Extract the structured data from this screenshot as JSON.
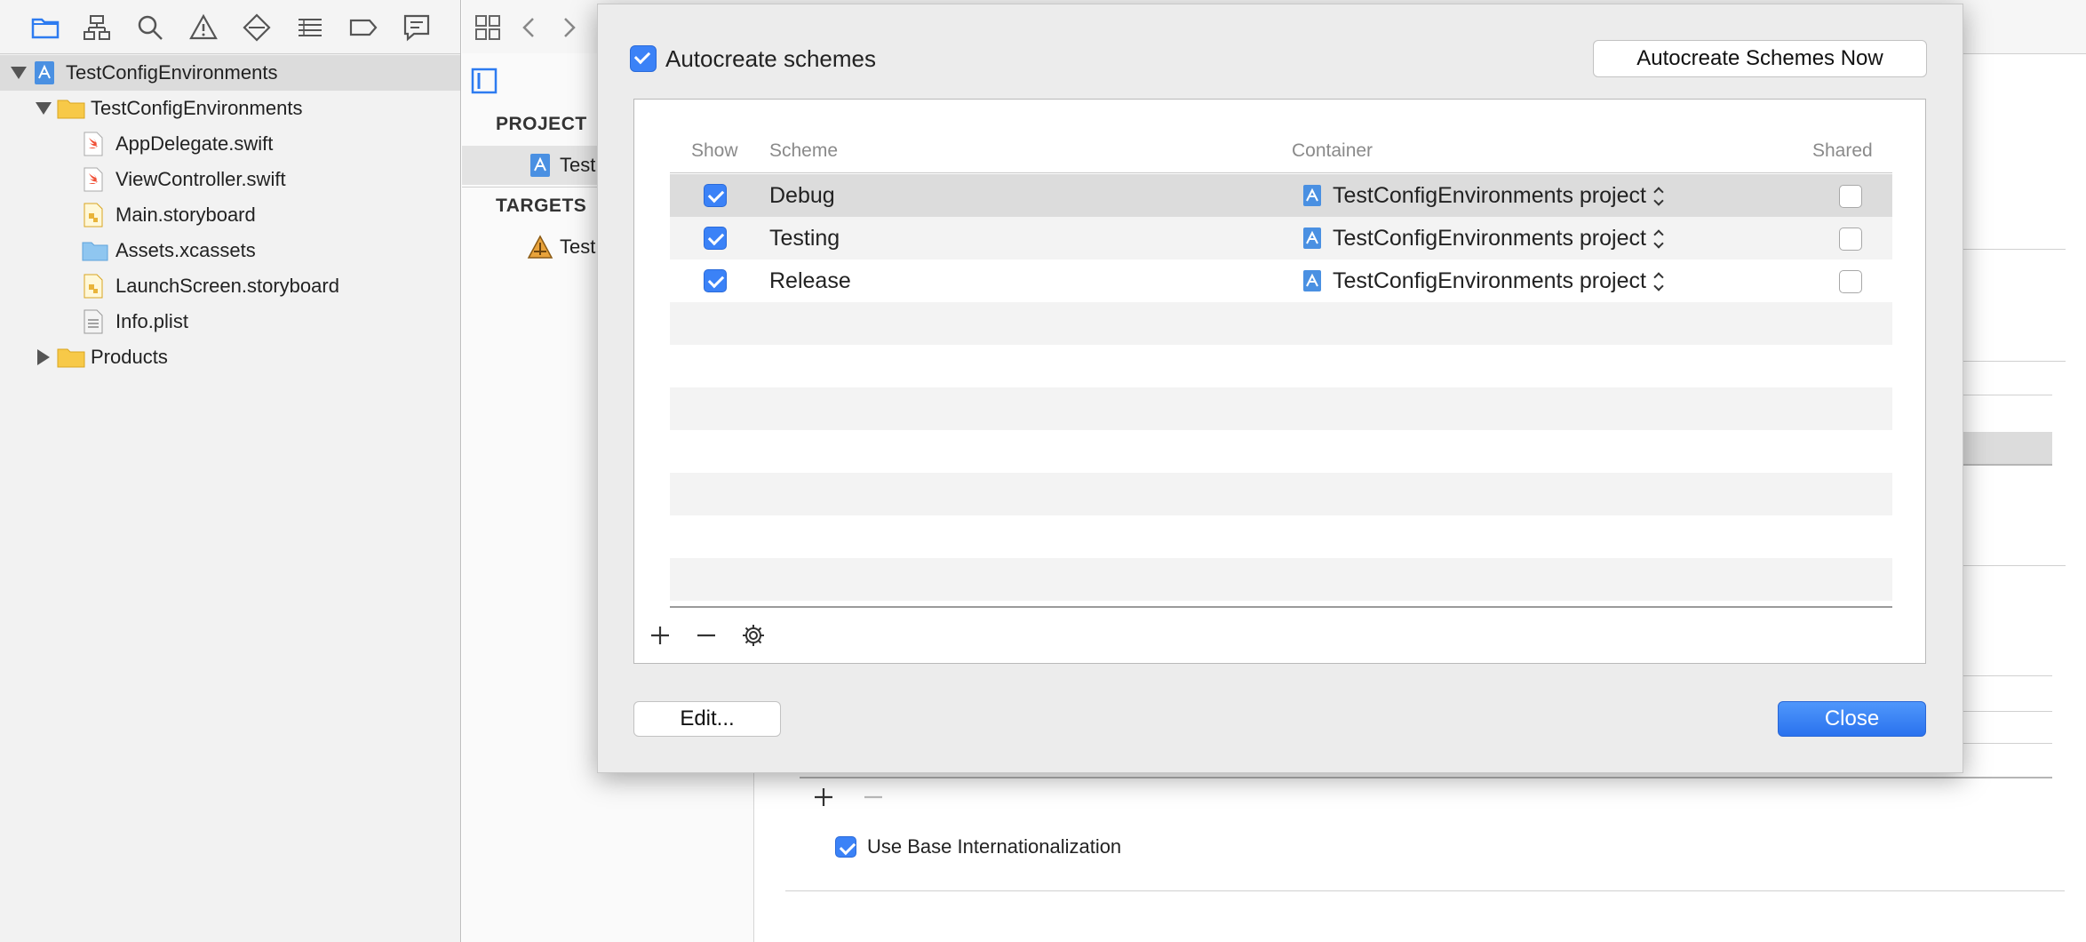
{
  "navigator": {
    "toolbar_icons": [
      "folder-icon",
      "hierarchy-icon",
      "search-icon",
      "warning-icon",
      "test-diamond-icon",
      "list-icon",
      "label-tag-icon",
      "comment-icon"
    ],
    "tree": [
      {
        "label": "TestConfigEnvironments",
        "icon": "xcode-project-icon",
        "depth": 0,
        "disclosure": "down",
        "selected": true
      },
      {
        "label": "TestConfigEnvironments",
        "icon": "folder-yellow-icon",
        "depth": 1,
        "disclosure": "down"
      },
      {
        "label": "AppDelegate.swift",
        "icon": "swift-file-icon",
        "depth": 2
      },
      {
        "label": "ViewController.swift",
        "icon": "swift-file-icon",
        "depth": 2
      },
      {
        "label": "Main.storyboard",
        "icon": "storyboard-file-icon",
        "depth": 2
      },
      {
        "label": "Assets.xcassets",
        "icon": "asset-catalog-icon",
        "depth": 2
      },
      {
        "label": "LaunchScreen.storyboard",
        "icon": "storyboard-file-icon",
        "depth": 2
      },
      {
        "label": "Info.plist",
        "icon": "plist-file-icon",
        "depth": 2
      },
      {
        "label": "Products",
        "icon": "folder-yellow-icon",
        "depth": 1,
        "disclosure": "right"
      }
    ]
  },
  "editor": {
    "project_header": "PROJECT",
    "project_item": "Test",
    "targets_header": "TARGETS",
    "target_item": "Test",
    "use_base_internationalization": "Use Base Internationalization"
  },
  "sheet": {
    "autocreate_label": "Autocreate schemes",
    "autocreate_now_button": "Autocreate Schemes Now",
    "columns": {
      "show": "Show",
      "scheme": "Scheme",
      "container": "Container",
      "shared": "Shared"
    },
    "schemes": [
      {
        "show": true,
        "name": "Debug",
        "container": "TestConfigEnvironments project",
        "shared": false
      },
      {
        "show": true,
        "name": "Testing",
        "container": "TestConfigEnvironments project",
        "shared": false
      },
      {
        "show": true,
        "name": "Release",
        "container": "TestConfigEnvironments project",
        "shared": false
      }
    ],
    "edit_button": "Edit...",
    "close_button": "Close"
  },
  "colors": {
    "accent": "#3b82f7",
    "sheet_bg": "#ececec",
    "navigator_bg": "#f2f2f2"
  }
}
